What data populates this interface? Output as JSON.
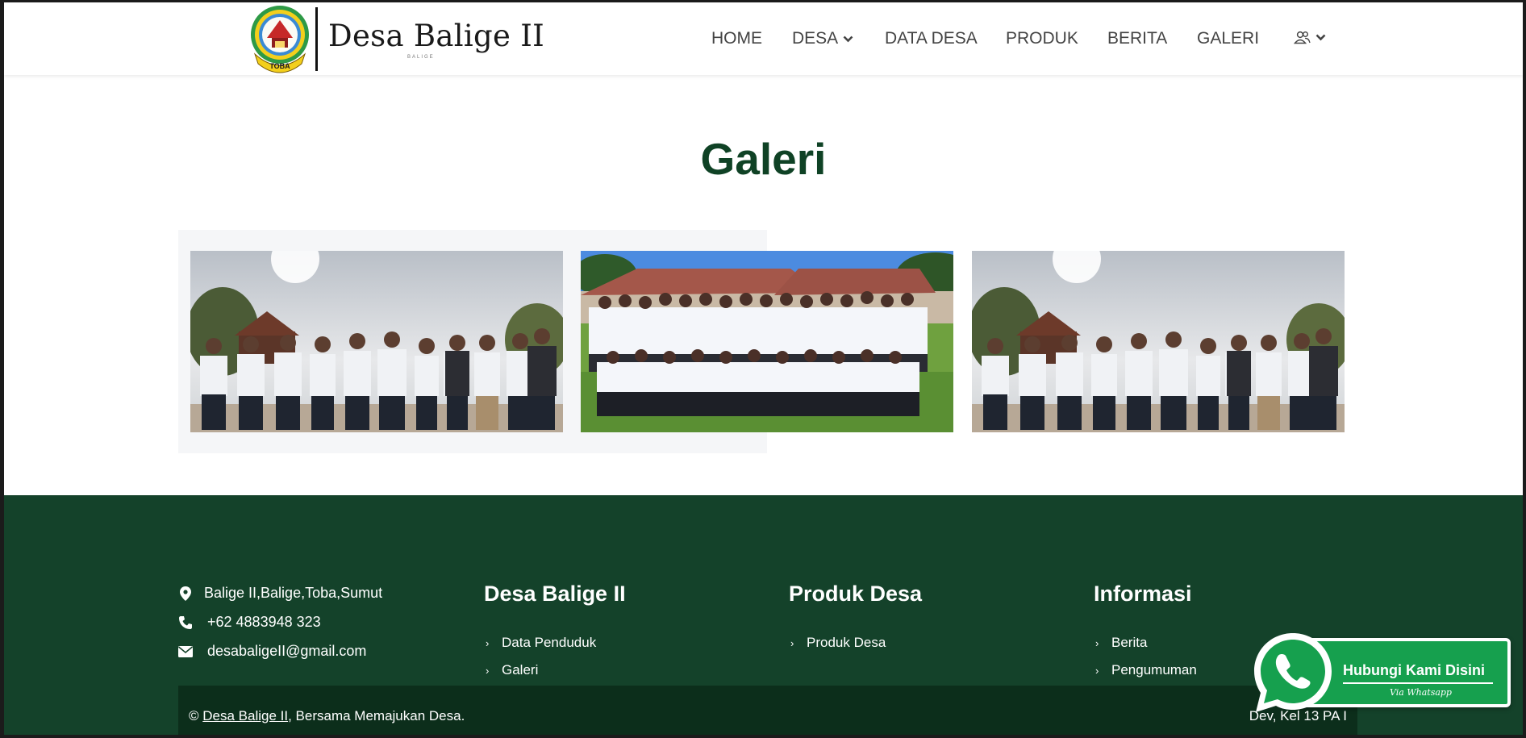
{
  "brand": {
    "name": "Desa Balige II",
    "tagline": "BALIGE",
    "emblem_text": "TOBA"
  },
  "nav": {
    "items": [
      {
        "label": "HOME",
        "dropdown": false
      },
      {
        "label": "DESA",
        "dropdown": true
      },
      {
        "label": "DATA DESA",
        "dropdown": false
      },
      {
        "label": "PRODUK",
        "dropdown": false
      },
      {
        "label": "BERITA",
        "dropdown": false
      },
      {
        "label": "GALERI",
        "dropdown": false
      }
    ],
    "user_icon": "users-icon"
  },
  "page": {
    "title": "Galeri"
  },
  "gallery": {
    "photos": [
      {
        "icon": "photo-group-standing"
      },
      {
        "icon": "photo-group-crowd"
      },
      {
        "icon": "photo-group-standing"
      }
    ]
  },
  "footer": {
    "contact": {
      "address": "Balige II,Balige,Toba,Sumut",
      "phone": "+62 4883948 323",
      "email": "desabaligeII@gmail.com"
    },
    "col_village": {
      "title": "Desa Balige II",
      "links": [
        "Data Penduduk",
        "Galeri"
      ]
    },
    "col_product": {
      "title": "Produk Desa",
      "links": [
        "Produk Desa"
      ]
    },
    "col_info": {
      "title": "Informasi",
      "links": [
        "Berita",
        "Pengumuman"
      ]
    },
    "copyright_prefix": "©",
    "copyright_link": "Desa Balige II",
    "copyright_suffix": ", Bersama Memajukan Desa.",
    "dev_credit": "Dev, Kel 13 PA I"
  },
  "whatsapp": {
    "label": "Hubungi Kami Disini",
    "sub": "Via Whatsapp"
  },
  "colors": {
    "primary_green": "#14422a",
    "title_green": "#0f4225",
    "dark_green": "#0c2e1b",
    "whatsapp_green": "#16a04e"
  }
}
